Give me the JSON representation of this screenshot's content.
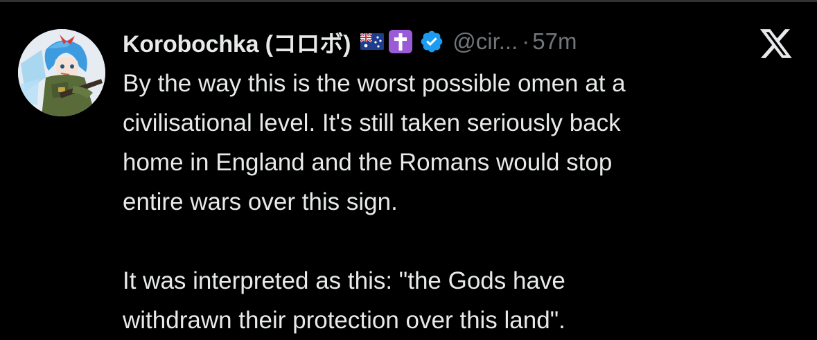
{
  "tweet": {
    "display_name": "Korobochka (コロボ)",
    "handle": "@cir...",
    "separator": "·",
    "time": "57m",
    "paragraph1": [
      "By the way this is the worst possible omen at a",
      "civilisational level. It's still taken seriously back",
      "home in England and the Romans would stop",
      "entire wars over this sign."
    ],
    "paragraph2": [
      "It was interpreted as this: \"the Gods have",
      "withdrawn their protection over this land\"."
    ]
  },
  "icons": {
    "flag": "australia-flag-emoji",
    "cross": "latin-cross-emoji",
    "verified": "verified-badge-icon",
    "brand": "x-logo-icon"
  },
  "colors": {
    "background": "#000000",
    "text": "#e7e9ea",
    "muted": "#71767b",
    "verified": "#1d9bf0",
    "cross_bg": "#9b5bd6"
  }
}
